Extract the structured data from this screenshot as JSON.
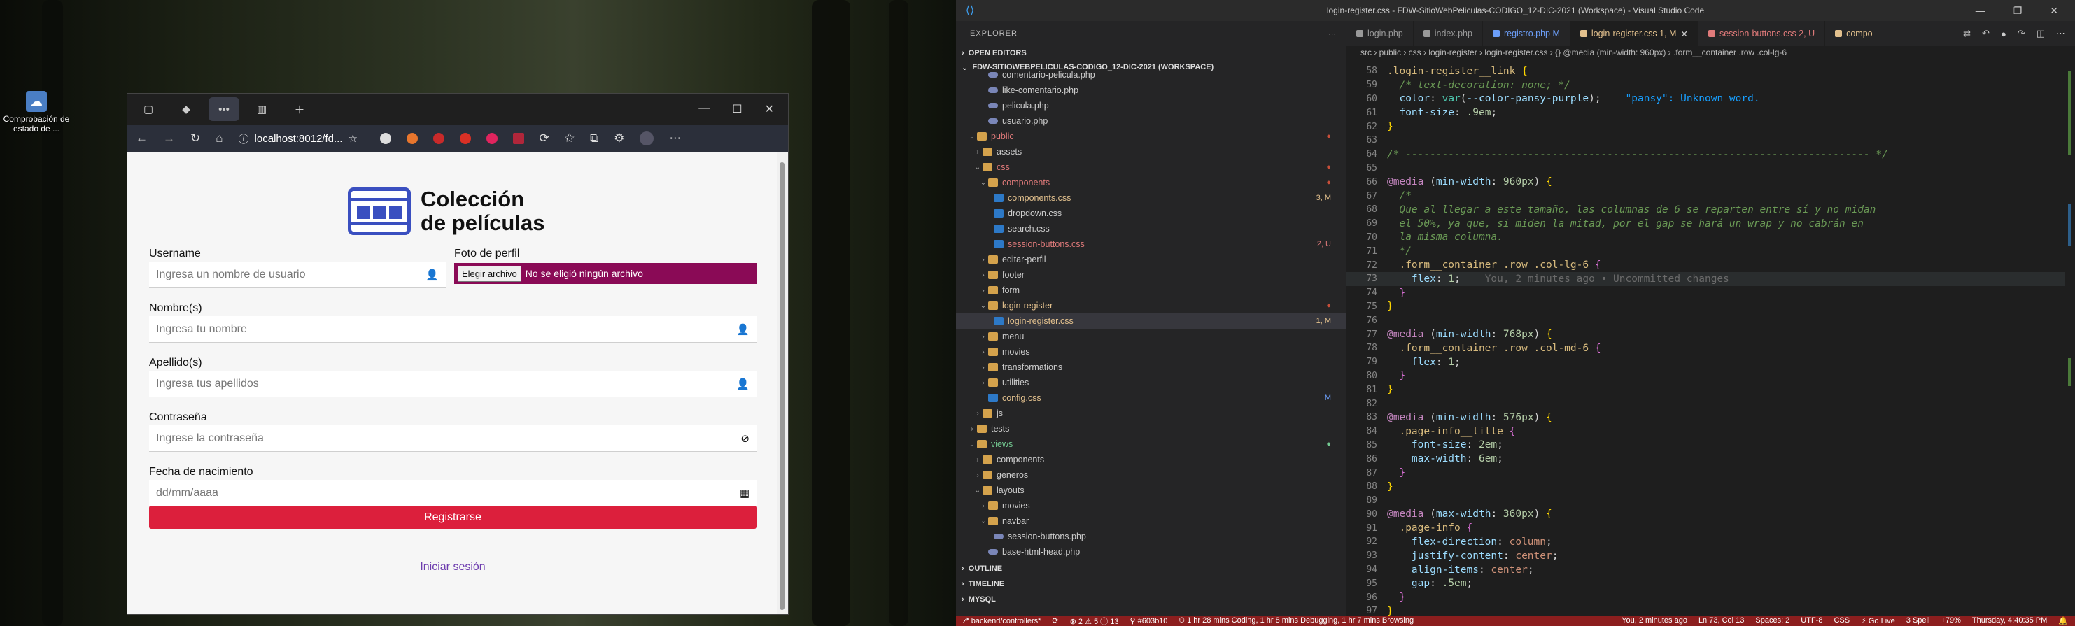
{
  "desktop": {
    "icon_label": "Comprobación de estado de ..."
  },
  "browser": {
    "url": "localhost:8012/fd...",
    "page": {
      "app_title_line1": "Colección",
      "app_title_line2": "de películas",
      "username_label": "Username",
      "username_placeholder": "Ingresa un nombre de usuario",
      "photo_label": "Foto de perfil",
      "file_button": "Elegir archivo",
      "file_status": "No se eligió ningún archivo",
      "name_label": "Nombre(s)",
      "name_placeholder": "Ingresa tu nombre",
      "lastname_label": "Apellido(s)",
      "lastname_placeholder": "Ingresa tus apellidos",
      "password_label": "Contraseña",
      "password_placeholder": "Ingrese la contraseña",
      "birth_label": "Fecha de nacimiento",
      "birth_placeholder": "dd/mm/aaaa",
      "submit": "Registrarse",
      "login_link": "Iniciar sesión"
    }
  },
  "vscode": {
    "title": "login-register.css - FDW-SitioWebPeliculas-CODIGO_12-DIC-2021 (Workspace) - Visual Studio Code",
    "explorer": "EXPLORER",
    "open_editors": "OPEN EDITORS",
    "workspace": "FDW-SITIOWEBPELICULAS-CODIGO_12-DIC-2021 (WORKSPACE)",
    "tree": [
      {
        "label": "comentario-pelicula.php",
        "indent": 3,
        "kind": "php"
      },
      {
        "label": "like-comentario.php",
        "indent": 3,
        "kind": "php"
      },
      {
        "label": "pelicula.php",
        "indent": 3,
        "kind": "php"
      },
      {
        "label": "usuario.php",
        "indent": 3,
        "kind": "php"
      },
      {
        "label": "public",
        "indent": 1,
        "kind": "folder-open",
        "color": "#e07a7a",
        "badge": "●",
        "badgeColor": "#c74e39"
      },
      {
        "label": "assets",
        "indent": 2,
        "kind": "folder"
      },
      {
        "label": "css",
        "indent": 2,
        "kind": "folder-open",
        "color": "#e07a7a",
        "badge": "●",
        "badgeColor": "#c74e39"
      },
      {
        "label": "components",
        "indent": 3,
        "kind": "folder-open",
        "color": "#e07a7a",
        "badge": "●",
        "badgeColor": "#c74e39"
      },
      {
        "label": "components.css",
        "indent": 4,
        "kind": "css",
        "color": "#e2c08d",
        "badge": "3, M",
        "badgeColor": "#e2c08d"
      },
      {
        "label": "dropdown.css",
        "indent": 4,
        "kind": "css"
      },
      {
        "label": "search.css",
        "indent": 4,
        "kind": "css"
      },
      {
        "label": "session-buttons.css",
        "indent": 4,
        "kind": "css",
        "color": "#e07a7a",
        "badge": "2, U",
        "badgeColor": "#e07a7a"
      },
      {
        "label": "editar-perfil",
        "indent": 3,
        "kind": "folder"
      },
      {
        "label": "footer",
        "indent": 3,
        "kind": "folder"
      },
      {
        "label": "form",
        "indent": 3,
        "kind": "folder"
      },
      {
        "label": "login-register",
        "indent": 3,
        "kind": "folder-open",
        "color": "#e2c08d",
        "badge": "●",
        "badgeColor": "#c74e39"
      },
      {
        "label": "login-register.css",
        "indent": 4,
        "kind": "css",
        "color": "#e2c08d",
        "badge": "1, M",
        "badgeColor": "#e2c08d",
        "selected": true
      },
      {
        "label": "menu",
        "indent": 3,
        "kind": "folder"
      },
      {
        "label": "movies",
        "indent": 3,
        "kind": "folder"
      },
      {
        "label": "transformations",
        "indent": 3,
        "kind": "folder"
      },
      {
        "label": "utilities",
        "indent": 3,
        "kind": "folder"
      },
      {
        "label": "config.css",
        "indent": 3,
        "kind": "css",
        "color": "#e2c08d",
        "badge": "M",
        "badgeColor": "#6c9ef8"
      },
      {
        "label": "js",
        "indent": 2,
        "kind": "folder"
      },
      {
        "label": "tests",
        "indent": 1,
        "kind": "folder"
      },
      {
        "label": "views",
        "indent": 1,
        "kind": "folder-open",
        "color": "#73c991",
        "badge": "●",
        "badgeColor": "#73c991"
      },
      {
        "label": "components",
        "indent": 2,
        "kind": "folder"
      },
      {
        "label": "generos",
        "indent": 2,
        "kind": "folder"
      },
      {
        "label": "layouts",
        "indent": 2,
        "kind": "folder-open"
      },
      {
        "label": "movies",
        "indent": 3,
        "kind": "folder"
      },
      {
        "label": "navbar",
        "indent": 3,
        "kind": "folder-open"
      },
      {
        "label": "session-buttons.php",
        "indent": 4,
        "kind": "php"
      },
      {
        "label": "base-html-head.php",
        "indent": 3,
        "kind": "php"
      }
    ],
    "outline": "OUTLINE",
    "timeline": "TIMELINE",
    "mysql": "MYSQL",
    "tabs": [
      {
        "label": "login.php",
        "color": "#999"
      },
      {
        "label": "index.php",
        "color": "#999"
      },
      {
        "label": "registro.php M",
        "color": "#6c9ef8"
      },
      {
        "label": "login-register.css 1, M",
        "color": "#e2c08d",
        "active": true
      },
      {
        "label": "session-buttons.css 2, U",
        "color": "#e07a7a"
      },
      {
        "label": "compo",
        "color": "#e2c08d"
      }
    ],
    "breadcrumbs": "src › public › css › login-register › login-register.css › {} @media (min-width: 960px) › .form__container .row .col-lg-6",
    "status": {
      "branch": "backend/controllers*",
      "problems": "⊗ 2 ⚠ 5 ⓘ 13",
      "commit": "#603b10",
      "time": "1 hr 28 mins Coding, 1 hr 8 mins Debugging, 1 hr 7 mins Browsing",
      "blame": "You, 2 minutes ago",
      "position": "Ln 73, Col 13",
      "spaces": "Spaces: 2",
      "encoding": "UTF-8",
      "lang": "CSS",
      "golive": "Go Live",
      "spell": "3 Spell",
      "zoom": "+79%",
      "clock": "Thursday, 4:40:35 PM"
    }
  }
}
